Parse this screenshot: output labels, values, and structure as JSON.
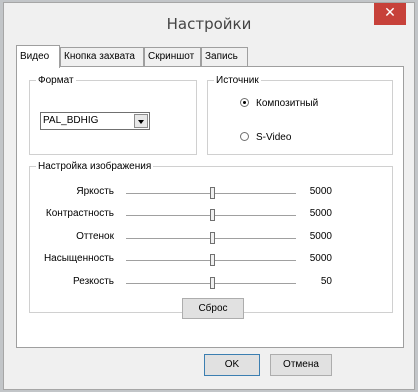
{
  "window": {
    "title": "Настройки",
    "close_glyph": "✕"
  },
  "tabs": [
    {
      "label": "Видео"
    },
    {
      "label": "Кнопка захвата"
    },
    {
      "label": "Скриншот"
    },
    {
      "label": "Запись"
    }
  ],
  "format_group": {
    "title": "Формат",
    "selected": "PAL_BDHIG"
  },
  "source_group": {
    "title": "Источник",
    "options": [
      {
        "label": "Композитный",
        "checked": true
      },
      {
        "label": "S-Video",
        "checked": false
      }
    ]
  },
  "image_group": {
    "title": "Настройка изображения",
    "sliders": [
      {
        "label": "Яркость",
        "value": "5000"
      },
      {
        "label": "Контрастность",
        "value": "5000"
      },
      {
        "label": "Оттенок",
        "value": "5000"
      },
      {
        "label": "Насыщенность",
        "value": "5000"
      },
      {
        "label": "Резкость",
        "value": "50"
      }
    ],
    "reset_label": "Сброс"
  },
  "footer": {
    "ok_label": "OK",
    "cancel_label": "Отмена"
  },
  "colors": {
    "close_button": "#c7413a",
    "window_bg": "#f0f0f0",
    "panel_bg": "#ffffff"
  }
}
